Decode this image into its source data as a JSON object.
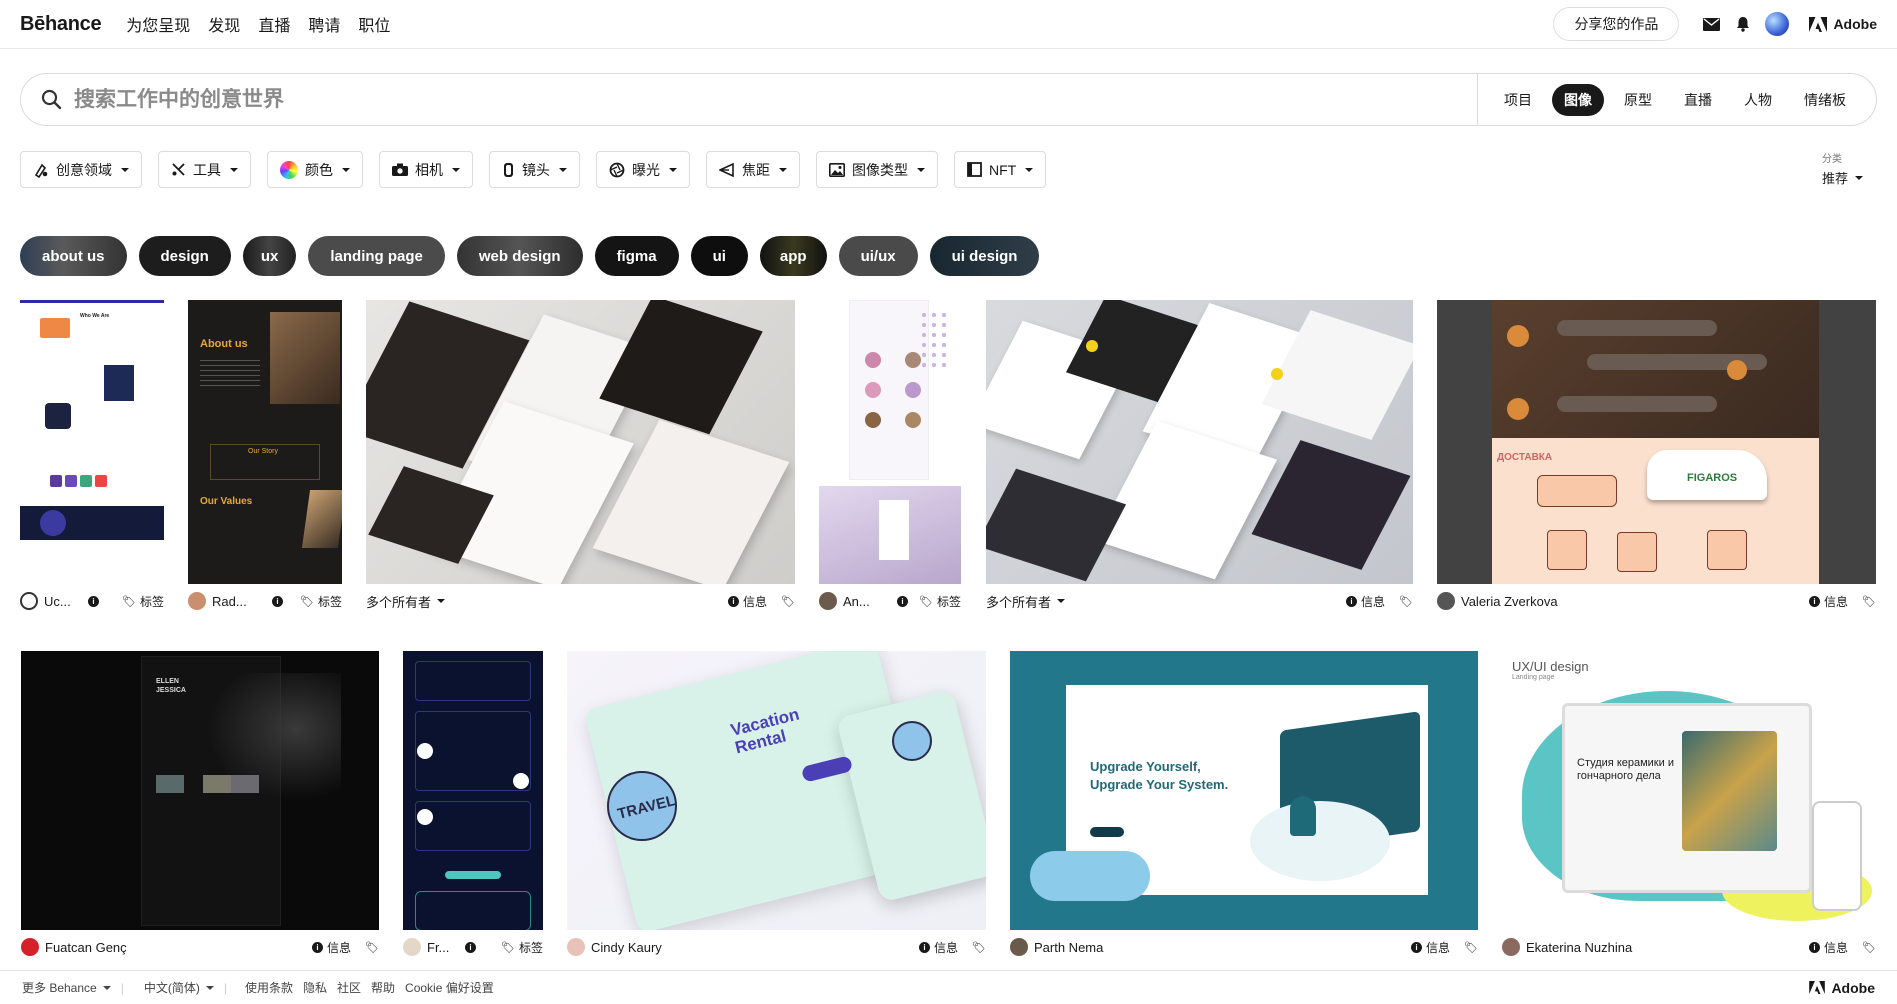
{
  "nav": {
    "logo": "Bēhance",
    "links": [
      "为您呈现",
      "发现",
      "直播",
      "聘请",
      "职位"
    ],
    "share_button": "分享您的作品",
    "adobe": "Adobe"
  },
  "search": {
    "placeholder": "搜索工作中的创意世界",
    "tabs": [
      "项目",
      "图像",
      "原型",
      "直播",
      "人物",
      "情绪板"
    ],
    "active_tab": "图像"
  },
  "filters": [
    {
      "label": "创意领域",
      "icon": "creative-field-icon"
    },
    {
      "label": "工具",
      "icon": "tools-icon"
    },
    {
      "label": "颜色",
      "icon": "color-wheel-icon"
    },
    {
      "label": "相机",
      "icon": "camera-icon"
    },
    {
      "label": "镜头",
      "icon": "lens-icon"
    },
    {
      "label": "曝光",
      "icon": "aperture-icon"
    },
    {
      "label": "焦距",
      "icon": "focal-length-icon"
    },
    {
      "label": "图像类型",
      "icon": "image-icon"
    },
    {
      "label": "NFT",
      "icon": "nft-icon"
    }
  ],
  "sort": {
    "label": "分类",
    "value": "推荐"
  },
  "tags": [
    "about us",
    "design",
    "ux",
    "landing page",
    "web design",
    "figma",
    "ui",
    "app",
    "ui/ux",
    "ui design"
  ],
  "tag_colors": [
    "#3a3a3a",
    "#1c1c1c",
    "#2a2a2a",
    "#4a4a4a",
    "#3f3f3f",
    "#151515",
    "#111111",
    "#1a1a1a",
    "#474747",
    "#1f2f3a"
  ],
  "cards": [
    {
      "owner": "Uc...",
      "action": "标签",
      "icon": "info-icon"
    },
    {
      "owner": "Rad...",
      "action": "标签",
      "icon": "info-icon"
    },
    {
      "owner": "多个所有者",
      "action": "信息",
      "icon": "tag-icon"
    },
    {
      "owner": "An...",
      "action": "标签",
      "icon": "info-icon"
    },
    {
      "owner": "多个所有者",
      "action": "信息",
      "icon": "tag-icon"
    },
    {
      "owner": "Valeria Zverkova",
      "action": "信息",
      "icon": "tag-icon"
    },
    {
      "owner": "Fuatcan Genç",
      "action": "信息",
      "icon": "tag-icon"
    },
    {
      "owner": "Fr...",
      "action": "标签",
      "icon": "info-icon"
    },
    {
      "owner": "Cindy Kaury",
      "action": "信息",
      "icon": "tag-icon"
    },
    {
      "owner": "Parth Nema",
      "action": "信息",
      "icon": "tag-icon"
    },
    {
      "owner": "Ekaterina Nuzhina",
      "action": "信息",
      "icon": "tag-icon"
    }
  ],
  "thumb_text": {
    "about_us": "About us",
    "our_story": "Our Story",
    "our_values": "Our Values",
    "who_we_are": "Who We Are",
    "ellen": "ELLEN JESSICA",
    "vacation": "Vacation Rental",
    "travel": "TRAVEL",
    "upgrade_1": "Upgrade Yourself,",
    "upgrade_2": "Upgrade Your System.",
    "uxui": "UX/UI design",
    "landing": "Landing page",
    "studio": "Студия керамики и гончарного дела",
    "figaros": "FIGAROS",
    "dostavka": "ДОСТАВКА"
  },
  "footer": {
    "more": "更多 Behance",
    "lang": "中文(简体)",
    "links": [
      "使用条款",
      "隐私",
      "社区",
      "帮助",
      "Cookie 偏好设置"
    ],
    "adobe": "Adobe"
  },
  "colors": {
    "accent": "#191919",
    "border": "#dadada"
  }
}
